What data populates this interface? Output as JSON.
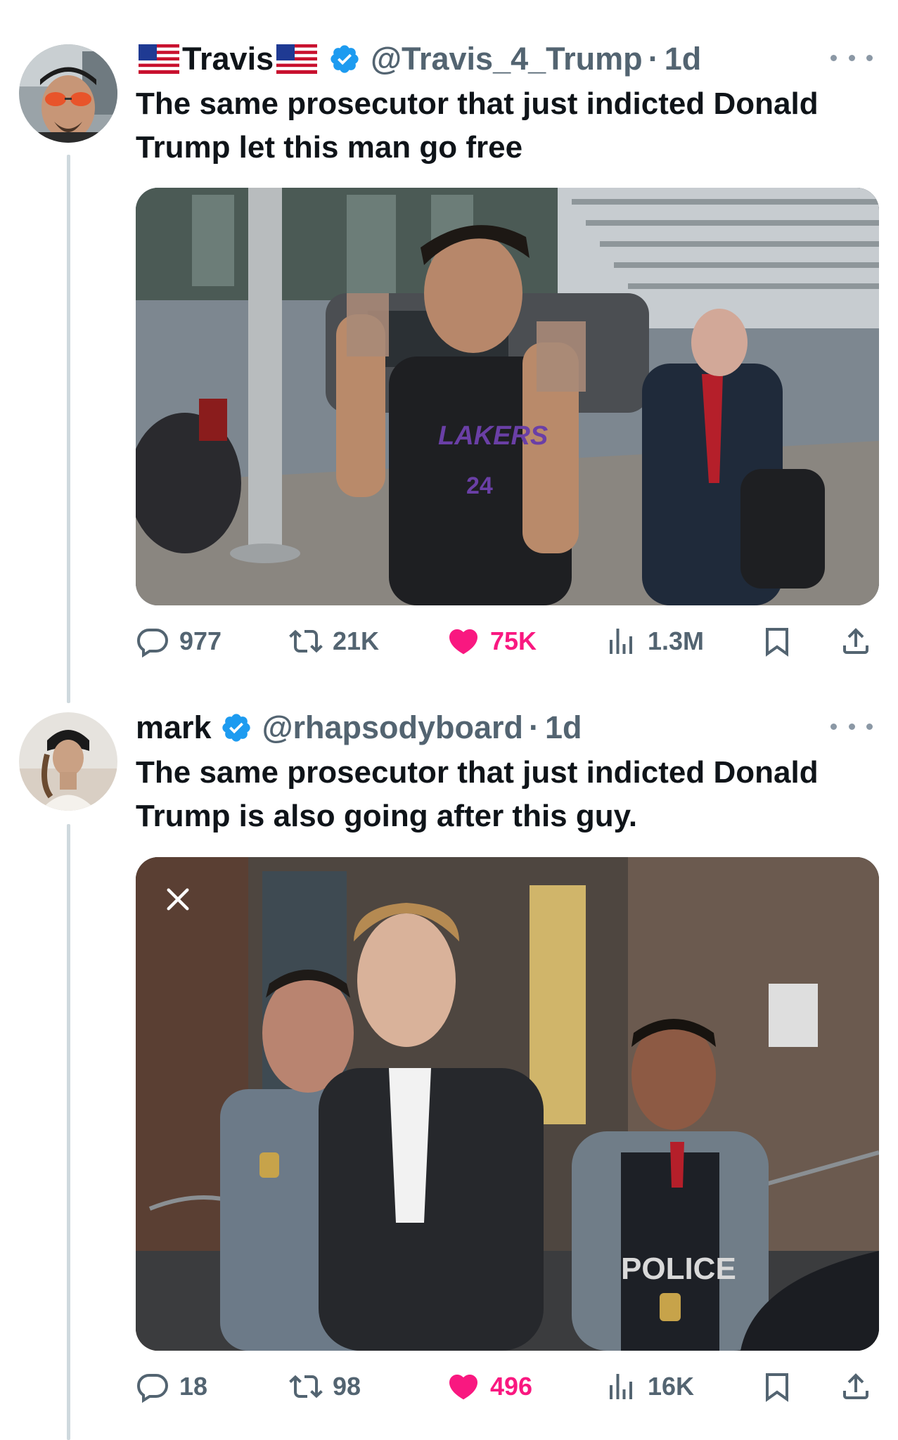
{
  "tweets": [
    {
      "name": "Travis",
      "handle": "@Travis_4_Trump",
      "separator": "·",
      "time": "1d",
      "text": "The same prosecutor that just indicted Donald Trump let this man go free",
      "stats": {
        "replies": "977",
        "retweets": "21K",
        "likes": "75K",
        "views": "1.3M"
      },
      "liked": true
    },
    {
      "name": "mark",
      "handle": "@rhapsodyboard",
      "separator": "·",
      "time": "1d",
      "text": "The same prosecutor that just indicted Donald Trump is also going after this guy.",
      "stats": {
        "replies": "18",
        "retweets": "98",
        "likes": "496",
        "views": "16K"
      },
      "liked": true
    }
  ],
  "media_text": {
    "jersey_team": "LAKERS",
    "jersey_number": "24",
    "vest_text": "POLICE"
  },
  "icons": {
    "verified": "verified-badge-icon",
    "flag": "us-flag-icon",
    "reply": "reply-icon",
    "retweet": "retweet-icon",
    "like": "heart-icon",
    "views": "views-icon",
    "bookmark": "bookmark-icon",
    "share": "share-icon",
    "more": "more-icon",
    "close": "close-icon"
  },
  "colors": {
    "verified": "#1d9bf0",
    "like_active": "#f91880",
    "secondary_text": "#536471",
    "thread_line": "#cfd9de"
  }
}
